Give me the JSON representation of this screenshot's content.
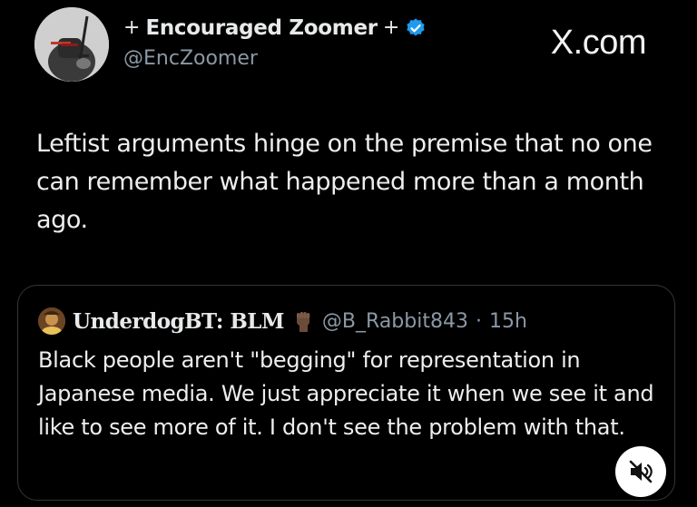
{
  "brand": {
    "text": "X.com"
  },
  "author": {
    "display_name": "Encouraged Zoomer",
    "name_prefix_glyph": "+",
    "name_suffix_glyph": "+",
    "handle": "@EncZoomer",
    "verified": true,
    "avatar_icon": "knight-avatar"
  },
  "tweet": {
    "text": "Leftist arguments hinge on the premise that no one can remember what happened more than a month ago."
  },
  "quoted_tweet": {
    "display_name": "UnderdogBT: BLM",
    "emoji": "raised-fist-icon",
    "handle": "@B_Rabbit843",
    "separator": "·",
    "time": "15h",
    "text": "Black people aren't \"begging\" for representation in Japanese media. We just appreciate it when we see it and like to see more of it. I don't see the problem with that."
  },
  "media_controls": {
    "mute_icon": "speaker-muted-icon"
  },
  "colors": {
    "background": "#000000",
    "text_primary": "#e7e9ea",
    "text_secondary": "#8b98a5",
    "verified_blue": "#1d9bf0",
    "card_border": "#333639"
  }
}
